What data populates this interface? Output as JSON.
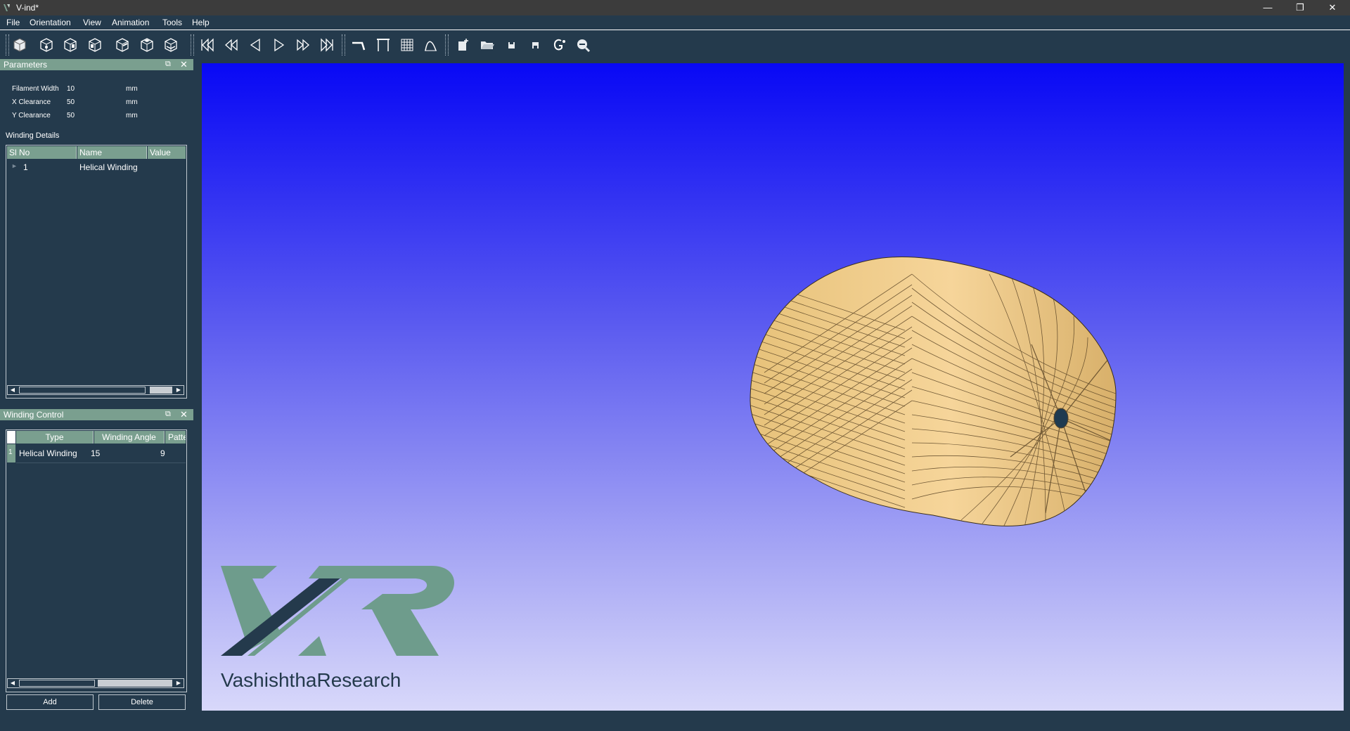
{
  "window": {
    "title": "V-ind*",
    "minimize_icon": "minimize-icon",
    "maximize_icon": "restore-icon",
    "close_icon": "close-icon"
  },
  "menu": [
    "File",
    "Orientation",
    "View",
    "Animation",
    "Tools",
    "Help"
  ],
  "toolbar_icons": [
    "view-iso-icon",
    "view-front-icon",
    "view-back-icon",
    "view-left-icon",
    "view-right-icon",
    "view-top-icon",
    "view-bottom-icon",
    "skip-first-icon",
    "step-back-icon",
    "play-reverse-icon",
    "play-icon",
    "step-forward-icon",
    "skip-last-icon",
    "path-icon",
    "frame-icon",
    "grid-icon",
    "curve-icon",
    "new-file-icon",
    "open-folder-icon",
    "save-icon",
    "save-as-icon",
    "gcode-icon",
    "zoom-icon"
  ],
  "parameters_panel": {
    "title": "Parameters",
    "rows": [
      {
        "label": "Filament Width",
        "value": "10",
        "unit": "mm"
      },
      {
        "label": "X Clearance",
        "value": "50",
        "unit": "mm"
      },
      {
        "label": "Y Clearance",
        "value": "50",
        "unit": "mm"
      }
    ],
    "section_label": "Winding Details",
    "table": {
      "headers": [
        "Sl No",
        "Name",
        "Value"
      ],
      "rows": [
        {
          "sl": "1",
          "name": "Helical Winding",
          "value": ""
        }
      ]
    }
  },
  "winding_control_panel": {
    "title": "Winding Control",
    "table": {
      "headers": [
        "Type",
        "Winding Angle",
        "Patter"
      ],
      "rows": [
        {
          "index": "1",
          "type": "Helical Winding",
          "angle": "15",
          "pattern": "9"
        }
      ]
    },
    "add_label": "Add",
    "delete_label": "Delete"
  },
  "viewport": {
    "watermark": {
      "part1": "Vashishtha",
      "part2": "Research"
    },
    "colors": {
      "gradient_top": "#0808f5",
      "gradient_bottom": "#d8d8fa",
      "model": "#f0c880",
      "logo_green": "#6e9c8c",
      "logo_dark": "#243a4c"
    }
  }
}
